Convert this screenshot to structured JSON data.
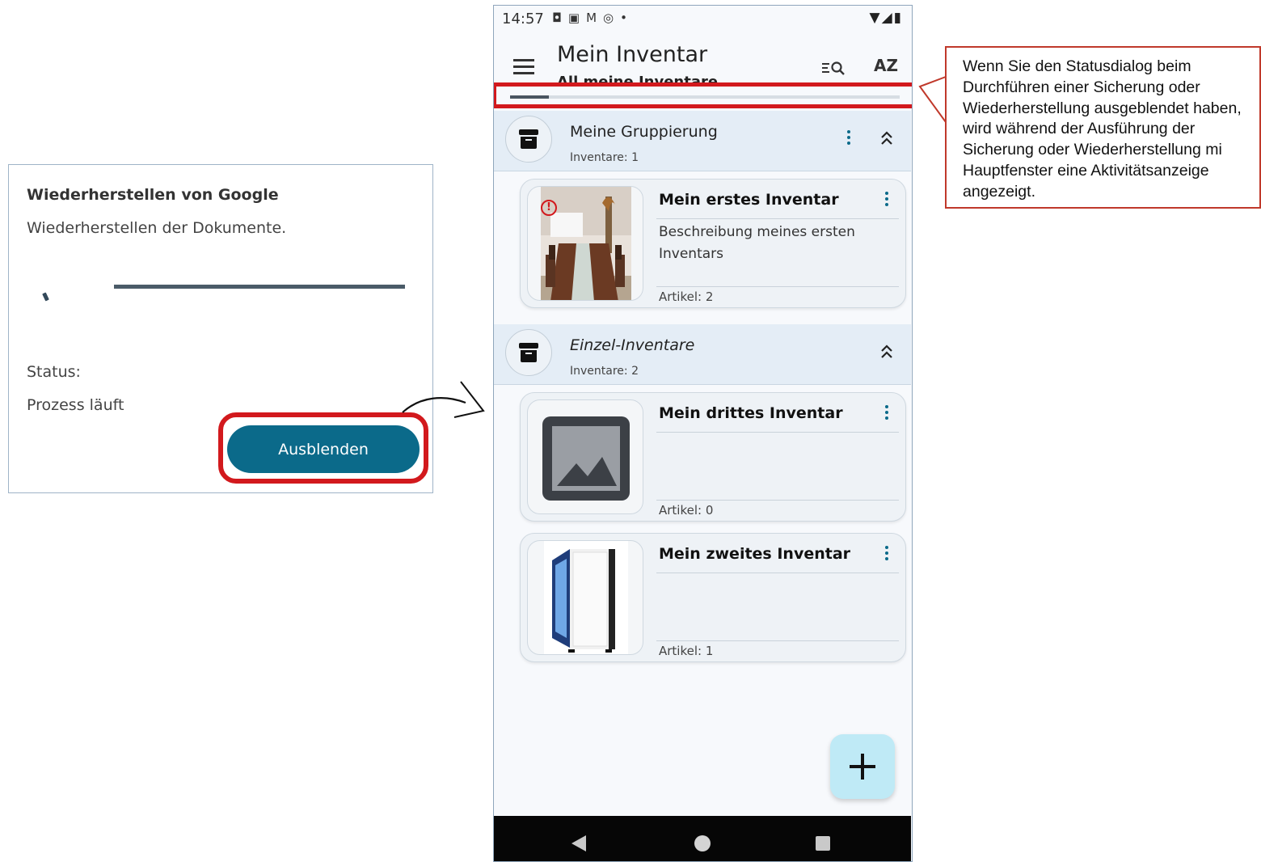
{
  "dialog": {
    "title": "Wiederherstellen von Google",
    "message": "Wiederherstellen der Dokumente.",
    "status_label": "Status:",
    "status_value": "Prozess läuft",
    "hide_button": "Ausblenden"
  },
  "phone": {
    "status_bar": {
      "time": "14:57",
      "icons": [
        "notification-a-icon",
        "calendar-icon",
        "gmail-icon",
        "sync-icon",
        "dot-icon"
      ],
      "right_icons": [
        "wifi-icon",
        "signal-icon",
        "battery-icon"
      ]
    },
    "app_bar": {
      "title": "Mein Inventar",
      "subtitle": "All meine Inventare",
      "sort_label": "AZ"
    },
    "progress": {
      "fraction": 0.1
    },
    "groups": [
      {
        "title": "Meine Gruppierung",
        "count": "Inventare: 1"
      },
      {
        "title": "Einzel-Inventare",
        "count": "Inventare: 2"
      }
    ],
    "cards": [
      {
        "title": "Mein erstes Inventar",
        "description": "Beschreibung meines ersten Inventars",
        "count": "Artikel: 2",
        "image": "dining-room-photo"
      },
      {
        "title": "Mein drittes Inventar",
        "description": "",
        "count": "Artikel: 0",
        "image": "image-placeholder-icon"
      },
      {
        "title": "Mein zweites Inventar",
        "description": "",
        "count": "Artikel: 1",
        "image": "pc-case-photo"
      }
    ],
    "fab_icon": "plus-icon"
  },
  "callout": {
    "text": "Wenn Sie den Statusdialog beim Durchführen einer Sicherung oder Wiederherstellung ausgeblendet haben, wird während der Ausführung der Sicherung oder Wiederherstellung mi Hauptfenster eine Aktivitätsanzeige angezeigt."
  },
  "colors": {
    "accent": "#0b6a8a",
    "highlight": "#d2191d",
    "group_bg": "#e4edf6",
    "fab_bg": "#bfeaf6"
  }
}
